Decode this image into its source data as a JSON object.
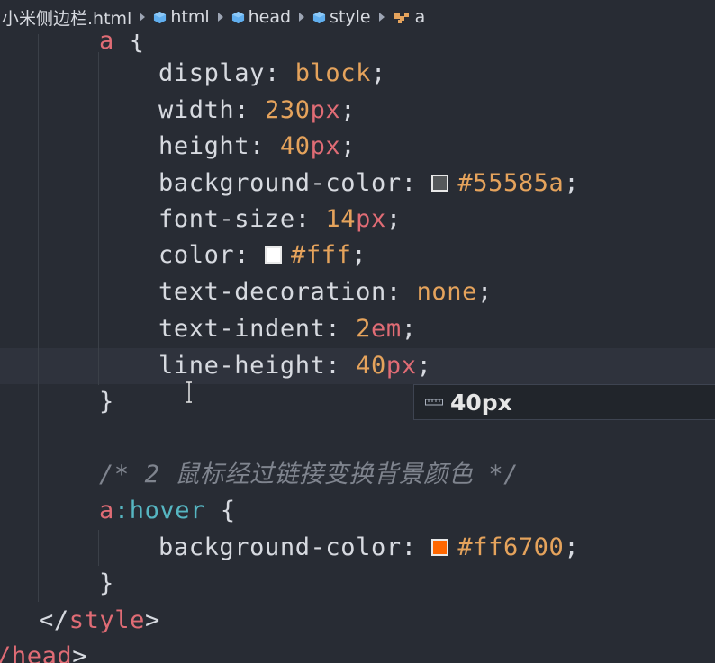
{
  "breadcrumb": {
    "items": [
      {
        "label": "小米侧边栏.html",
        "icon": null
      },
      {
        "label": "html",
        "icon": "cube-icon"
      },
      {
        "label": "head",
        "icon": "cube-icon"
      },
      {
        "label": "style",
        "icon": "cube-icon"
      },
      {
        "label": "a",
        "icon": "symbol-rule-icon"
      }
    ]
  },
  "code": {
    "selector_a": "a",
    "open_brace": "{",
    "props": [
      {
        "name": "display",
        "value": "block"
      },
      {
        "name": "width",
        "num": "230",
        "unit": "px"
      },
      {
        "name": "height",
        "num": "40",
        "unit": "px"
      },
      {
        "name": "background-color",
        "value": "#55585a",
        "swatch": "#55585a"
      },
      {
        "name": "font-size",
        "num": "14",
        "unit": "px"
      },
      {
        "name": "color",
        "value": "#fff",
        "swatch": "#ffffff"
      },
      {
        "name": "text-decoration",
        "value": "none"
      },
      {
        "name": "text-indent",
        "num": "2",
        "unit": "em"
      },
      {
        "name": "line-height",
        "num": "40",
        "unit": "px"
      }
    ],
    "close_brace": "}",
    "comment": "/* 2 鼠标经过链接变换背景颜色 */",
    "hover_selector_tag": "a",
    "hover_selector_pseudo": ":hover",
    "hover_open": " {",
    "hover_prop": {
      "name": "background-color",
      "value": "#ff6700",
      "swatch": "#ff6700"
    },
    "hover_close": "}",
    "style_close": "</style>",
    "head_close": "/head>"
  },
  "suggest": {
    "label": "40px",
    "icon": "unit-ruler-icon"
  },
  "colors": {
    "background": "#282c34",
    "property": "#d7dae0",
    "value": "#e5a35c",
    "unit": "#e06c75",
    "tag": "#e06c75",
    "pseudo": "#56b6c2",
    "comment": "#7f848e"
  }
}
